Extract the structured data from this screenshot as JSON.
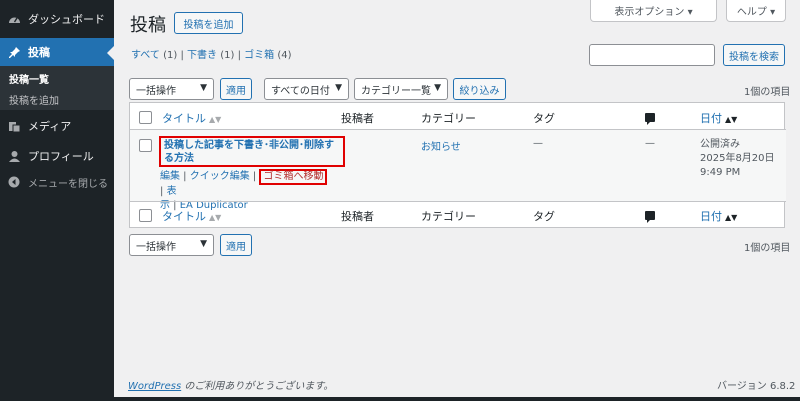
{
  "sidebar": {
    "items": [
      {
        "icon": "dashboard-icon",
        "label": "ダッシュボード"
      },
      {
        "icon": "pushpin-icon",
        "label": "投稿"
      },
      {
        "icon": "media-icon",
        "label": "メディア"
      },
      {
        "icon": "user-icon",
        "label": "プロフィール"
      },
      {
        "icon": "collapse-icon",
        "label": "メニューを閉じる"
      }
    ],
    "submenu": [
      "投稿一覧",
      "投稿を追加"
    ]
  },
  "topbar": {
    "screen_options": "表示オプション ▾",
    "help": "ヘルプ ▾"
  },
  "header": {
    "title": "投稿",
    "add_new": "投稿を追加"
  },
  "filters": {
    "all": "すべて",
    "all_count": "(1)",
    "drafts": "下書き",
    "drafts_count": "(1)",
    "trash": "ゴミ箱",
    "trash_count": "(4)",
    "sep": "|"
  },
  "search": {
    "button": "投稿を検索"
  },
  "tablenav_top": {
    "bulk": "一括操作",
    "apply": "適用",
    "dates": "すべての日付",
    "categories": "カテゴリー一覧",
    "filter": "絞り込み",
    "count": "1個の項目"
  },
  "table": {
    "headers": {
      "title": "タイトル",
      "author": "投稿者",
      "categories": "カテゴリー",
      "tags": "タグ",
      "date": "日付"
    },
    "row": {
      "title": "投稿した記事を下書き･非公開･削除する方法",
      "edit": "編集",
      "sep": " | ",
      "quick_edit": "クイック編集",
      "trash": "ゴミ箱へ移動",
      "view_1": "表",
      "view_2": "示",
      "duplicate": "EA Duplicator",
      "category": "お知らせ",
      "tags": "—",
      "comments": "—",
      "status": "公開済み",
      "date": "2025年8月20日",
      "time": "9:49 PM"
    }
  },
  "tablenav_bottom": {
    "bulk": "一括操作",
    "apply": "適用",
    "count": "1個の項目"
  },
  "footer": {
    "wp": "WordPress",
    "thanks": " のご利用ありがとうございます。",
    "version": "バージョン 6.8.2"
  }
}
